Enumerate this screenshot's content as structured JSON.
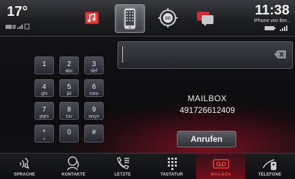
{
  "status": {
    "temperature": "17°",
    "time": "11:38",
    "phone_name": "iPhone von Ber..."
  },
  "top_tabs": [
    {
      "name": "music-icon",
      "active": false
    },
    {
      "name": "phone-icon",
      "active": true
    },
    {
      "name": "navigation-sd-icon",
      "active": false
    },
    {
      "name": "messages-icon",
      "active": false
    }
  ],
  "keypad": {
    "keys": [
      {
        "digit": "1",
        "letters": ""
      },
      {
        "digit": "2",
        "letters": "abc"
      },
      {
        "digit": "3",
        "letters": "def"
      },
      {
        "digit": "4",
        "letters": "ghi"
      },
      {
        "digit": "5",
        "letters": "jkl"
      },
      {
        "digit": "6",
        "letters": "mno"
      },
      {
        "digit": "7",
        "letters": "pqrs"
      },
      {
        "digit": "8",
        "letters": "tuv"
      },
      {
        "digit": "9",
        "letters": "wxyz"
      },
      {
        "digit": "*",
        "letters": "+"
      },
      {
        "digit": "0",
        "letters": ""
      },
      {
        "digit": "#",
        "letters": ""
      }
    ]
  },
  "mailbox": {
    "title": "MAILBOX",
    "number": "491726612409",
    "call_label": "Anrufen"
  },
  "bottom_tabs": [
    {
      "label": "SPRACHE",
      "icon": "voice-icon",
      "active": false
    },
    {
      "label": "KONTAKTE",
      "icon": "contacts-icon",
      "active": false
    },
    {
      "label": "LETZTE",
      "icon": "recent-calls-icon",
      "active": false
    },
    {
      "label": "TASTATUR",
      "icon": "keypad-icon",
      "active": false
    },
    {
      "label": "MAILBOX",
      "icon": "voicemail-icon",
      "active": true
    },
    {
      "label": "TELEFONE",
      "icon": "phones-icon",
      "active": false
    }
  ],
  "colors": {
    "accent_red": "#e0182c",
    "active_label": "#ff3b3b"
  }
}
